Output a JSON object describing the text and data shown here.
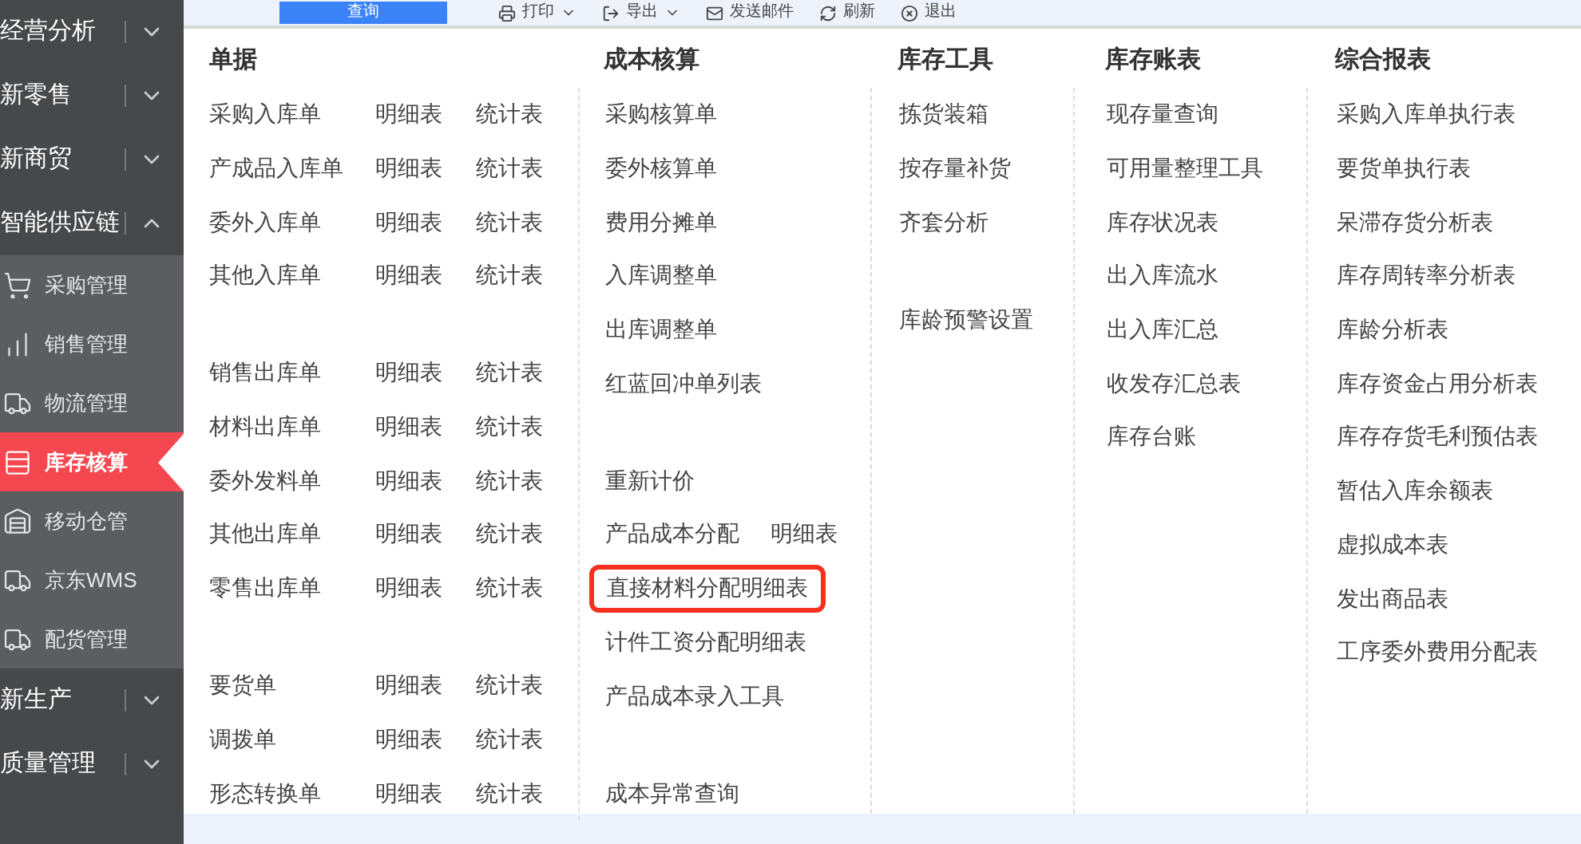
{
  "toolbar": [
    {
      "label": "查询",
      "kind": "primary"
    },
    {
      "label": "打印",
      "kind": "menu"
    },
    {
      "label": "导出",
      "kind": "menu"
    },
    {
      "label": "发送邮件",
      "kind": "plain"
    },
    {
      "label": "刷新",
      "kind": "plain"
    },
    {
      "label": "退出",
      "kind": "plain"
    }
  ],
  "sidebar": [
    {
      "label": "经营分析",
      "expanded": false
    },
    {
      "label": "新零售",
      "expanded": false
    },
    {
      "label": "新商贸",
      "expanded": false
    },
    {
      "label": "智能供应链",
      "expanded": true,
      "children": [
        {
          "label": "采购管理",
          "selected": false
        },
        {
          "label": "销售管理",
          "selected": false
        },
        {
          "label": "物流管理",
          "selected": false
        },
        {
          "label": "库存核算",
          "selected": true
        },
        {
          "label": "移动仓管",
          "selected": false
        },
        {
          "label": "京东WMS",
          "selected": false
        },
        {
          "label": "配货管理",
          "selected": false
        }
      ]
    },
    {
      "label": "新生产",
      "expanded": false
    },
    {
      "label": "质量管理",
      "expanded": false
    }
  ],
  "menu_columns": [
    {
      "title": "单据",
      "groups": [
        [
          {
            "label": "采购入库单",
            "links": [
              "明细表",
              "统计表"
            ],
            "highlighted": false
          },
          {
            "label": "产成品入库单",
            "links": [
              "明细表",
              "统计表"
            ],
            "highlighted": false
          },
          {
            "label": "委外入库单",
            "links": [
              "明细表",
              "统计表"
            ],
            "highlighted": false
          },
          {
            "label": "其他入库单",
            "links": [
              "明细表",
              "统计表"
            ],
            "highlighted": false
          }
        ],
        [
          {
            "label": "销售出库单",
            "links": [
              "明细表",
              "统计表"
            ],
            "highlighted": false
          },
          {
            "label": "材料出库单",
            "links": [
              "明细表",
              "统计表"
            ],
            "highlighted": false
          },
          {
            "label": "委外发料单",
            "links": [
              "明细表",
              "统计表"
            ],
            "highlighted": false
          },
          {
            "label": "其他出库单",
            "links": [
              "明细表",
              "统计表"
            ],
            "highlighted": false
          },
          {
            "label": "零售出库单",
            "links": [
              "明细表",
              "统计表"
            ],
            "highlighted": false
          }
        ],
        [
          {
            "label": "要货单",
            "links": [
              "明细表",
              "统计表"
            ],
            "highlighted": false
          },
          {
            "label": "调拨单",
            "links": [
              "明细表",
              "统计表"
            ],
            "highlighted": false
          },
          {
            "label": "形态转换单",
            "links": [
              "明细表",
              "统计表"
            ],
            "highlighted": false
          }
        ]
      ]
    },
    {
      "title": "成本核算",
      "groups": [
        [
          {
            "label": "采购核算单",
            "highlighted": false
          },
          {
            "label": "委外核算单",
            "highlighted": false
          },
          {
            "label": "费用分摊单",
            "highlighted": false
          },
          {
            "label": "入库调整单",
            "highlighted": false
          },
          {
            "label": "出库调整单",
            "highlighted": false
          },
          {
            "label": "红蓝回冲单列表",
            "highlighted": false
          }
        ],
        [
          {
            "label": "重新计价",
            "highlighted": false
          },
          {
            "label": "产品成本分配",
            "links": [
              "明细表"
            ],
            "highlighted": false
          },
          {
            "label": "直接材料分配明细表",
            "highlighted": true
          },
          {
            "label": "计件工资分配明细表",
            "highlighted": false
          },
          {
            "label": "产品成本录入工具",
            "highlighted": false
          }
        ],
        [
          {
            "label": "成本异常查询",
            "highlighted": false
          }
        ]
      ]
    },
    {
      "title": "库存工具",
      "groups": [
        [
          {
            "label": "拣货装箱",
            "highlighted": false
          },
          {
            "label": "按存量补货",
            "highlighted": false
          },
          {
            "label": "齐套分析",
            "highlighted": false
          }
        ],
        [
          {
            "label": "库龄预警设置",
            "highlighted": false
          }
        ]
      ]
    },
    {
      "title": "库存账表",
      "groups": [
        [
          {
            "label": "现存量查询",
            "highlighted": false
          },
          {
            "label": "可用量整理工具",
            "highlighted": false
          },
          {
            "label": "库存状况表",
            "highlighted": false
          },
          {
            "label": "出入库流水",
            "highlighted": false
          },
          {
            "label": "出入库汇总",
            "highlighted": false
          },
          {
            "label": "收发存汇总表",
            "highlighted": false
          },
          {
            "label": "库存台账",
            "highlighted": false
          }
        ]
      ]
    },
    {
      "title": "综合报表",
      "groups": [
        [
          {
            "label": "采购入库单执行表",
            "highlighted": false
          },
          {
            "label": "要货单执行表",
            "highlighted": false
          },
          {
            "label": "呆滞存货分析表",
            "highlighted": false
          },
          {
            "label": "库存周转率分析表",
            "highlighted": false
          },
          {
            "label": "库龄分析表",
            "highlighted": false
          },
          {
            "label": "库存资金占用分析表",
            "highlighted": false
          },
          {
            "label": "库存存货毛利预估表",
            "highlighted": false
          },
          {
            "label": "暂估入库余额表",
            "highlighted": false
          },
          {
            "label": "虚拟成本表",
            "highlighted": false
          },
          {
            "label": "发出商品表",
            "highlighted": false
          },
          {
            "label": "工序委外费用分配表",
            "highlighted": false
          }
        ]
      ]
    }
  ]
}
